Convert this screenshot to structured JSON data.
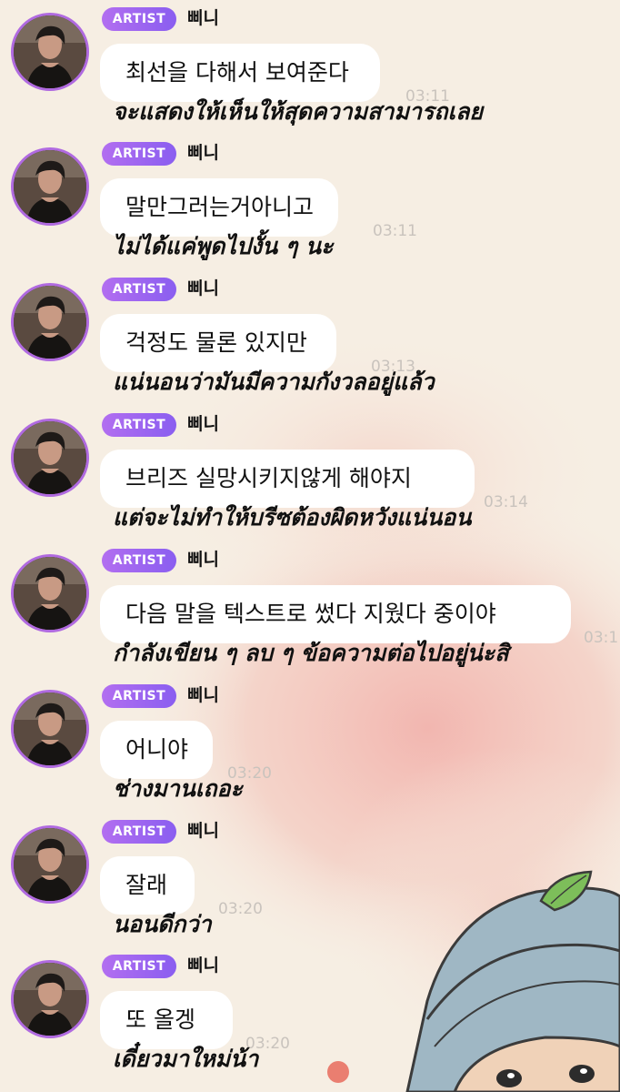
{
  "chat": {
    "messages": [
      {
        "badge": "ARTIST",
        "name": "삐니",
        "text": "최선을 다해서 보여준다",
        "time": "03:11",
        "translation": "จะแสดงให้เห็นให้สุดความสามารถเลย"
      },
      {
        "badge": "ARTIST",
        "name": "삐니",
        "text": "말만그러는거아니고",
        "time": "03:11",
        "translation": "ไม่ได้แค่พูดไปงั้น ๆ นะ"
      },
      {
        "badge": "ARTIST",
        "name": "삐니",
        "text": "걱정도 물론 있지만",
        "time": "03:13",
        "translation": "แน่นอนว่ามันมีความกังวลอยู่แล้ว"
      },
      {
        "badge": "ARTIST",
        "name": "삐니",
        "text": "브리즈 실망시키지않게 해야지",
        "time": "03:14",
        "translation": "แต่จะไม่ทำให้บรีซต้องผิดหวังแน่นอน"
      },
      {
        "badge": "ARTIST",
        "name": "삐니",
        "text": "다음 말을 텍스트로 썼다 지웠다 중이야",
        "time": "03:1",
        "translation": "กำลังเขียน ๆ ลบ ๆ ข้อความต่อไปอยู่น่ะสิ"
      },
      {
        "badge": "ARTIST",
        "name": "삐니",
        "text": "어니야",
        "time": "03:20",
        "translation": "ช่างมานเถอะ"
      },
      {
        "badge": "ARTIST",
        "name": "삐니",
        "text": "잘래",
        "time": "03:20",
        "translation": "นอนดีกว่า"
      },
      {
        "badge": "ARTIST",
        "name": "삐니",
        "text": "또 올겡",
        "time": "03:20",
        "translation": "เดี๋ยวมาใหม่น้า"
      }
    ]
  },
  "theme": {
    "background": "#f6eee3",
    "bubble": "#ffffff",
    "badge_gradient": [
      "#b26ef0",
      "#8a5ef0"
    ],
    "avatar_ring": "#b06ae0",
    "time_color": "#c9c3bd",
    "sticker": "person-with-blue-beanie-and-leaf-icon"
  }
}
